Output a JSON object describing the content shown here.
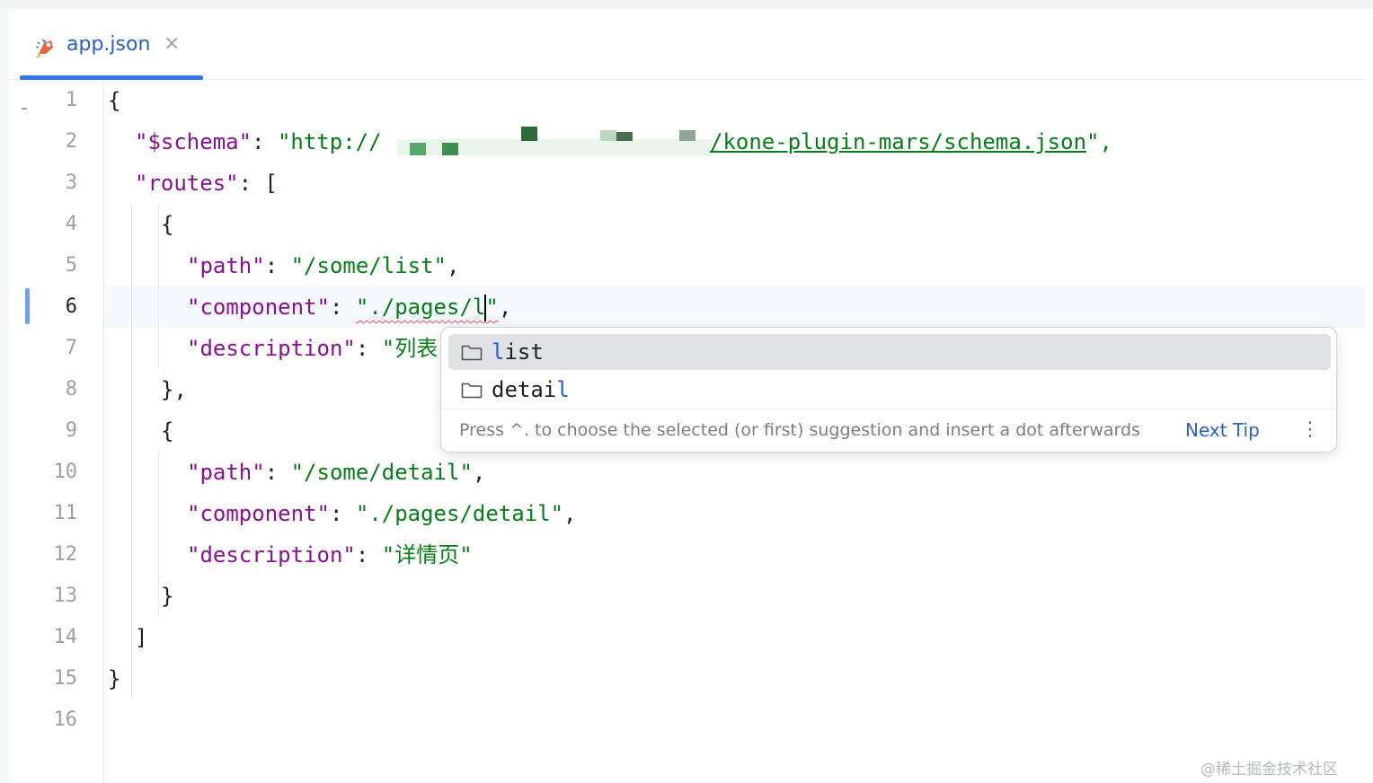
{
  "tab": {
    "filename": "app.json",
    "close_glyph": "×",
    "icon": "mars-rocket-icon"
  },
  "gutter": {
    "lines": [
      "1",
      "2",
      "3",
      "4",
      "5",
      "6",
      "7",
      "8",
      "9",
      "10",
      "11",
      "12",
      "13",
      "14",
      "15",
      "16"
    ],
    "current_line": "6"
  },
  "code": {
    "l1": "{",
    "l2_key": "\"$schema\"",
    "l2_colon": ": ",
    "l2_url_start": "\"http://",
    "l2_url_end": "/kone-plugin-mars/schema.json",
    "l2_tail": "\",",
    "l3_key": "\"routes\"",
    "l3_rest": ": [",
    "l4": "{",
    "l5_key": "\"path\"",
    "l5_colon": ": ",
    "l5_val": "\"/some/list\"",
    "l5_tail": ",",
    "l6_key": "\"component\"",
    "l6_colon": ": ",
    "l6_val_a": "\"./pages/l",
    "l6_val_b": "\"",
    "l6_tail": ",",
    "l7_key": "\"description\"",
    "l7_colon": ": ",
    "l7_val": "\"列表",
    "l8": "},",
    "l9": "{",
    "l10_key": "\"path\"",
    "l10_colon": ": ",
    "l10_val": "\"/some/detail\"",
    "l10_tail": ",",
    "l11_key": "\"component\"",
    "l11_colon": ": ",
    "l11_val": "\"./pages/detail\"",
    "l11_tail": ",",
    "l12_key": "\"description\"",
    "l12_colon": ": ",
    "l12_val": "\"详情页\"",
    "l13": "}",
    "l14": "]",
    "l15": "}"
  },
  "completion": {
    "items": [
      {
        "match": "l",
        "rest": "ist",
        "icon": "folder-icon"
      },
      {
        "prefix": "detai",
        "match": "l",
        "icon": "folder-icon"
      }
    ],
    "hint": "Press ^. to choose the selected (or first) suggestion and insert a dot afterwards",
    "next_tip": "Next Tip",
    "more": "⋮"
  },
  "watermark": "@稀土掘金技术社区",
  "colors": {
    "key": "#871094",
    "string": "#067d17",
    "accent": "#3574f0",
    "link": "#2c5ec8"
  }
}
